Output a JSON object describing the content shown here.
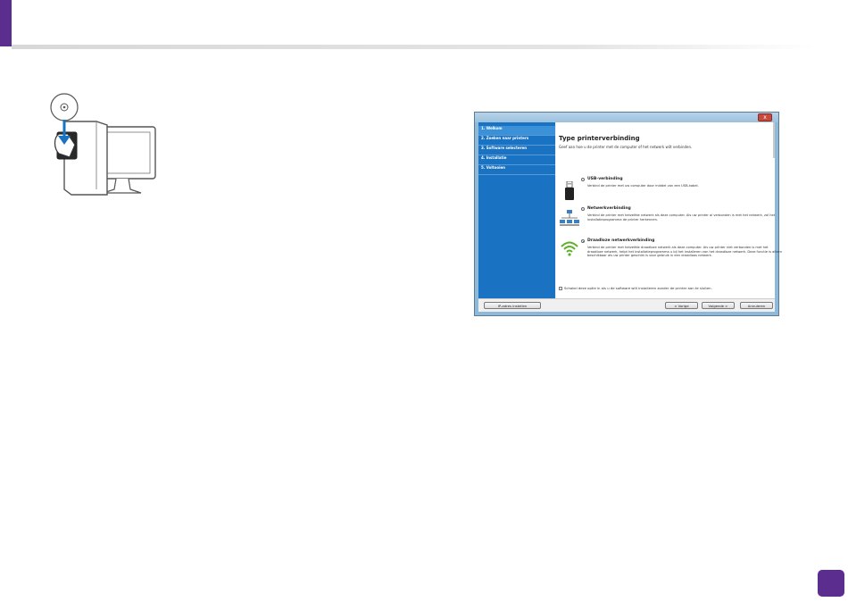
{
  "colors": {
    "accent": "#5b2d8e",
    "sidebar": "#1a73c2",
    "sidebar_active": "#3b91d8"
  },
  "installer": {
    "close_label": "x",
    "sidebar": [
      {
        "label": "1. Welkom"
      },
      {
        "label": "2. Zoeken naar printers"
      },
      {
        "label": "3. Software selecteren"
      },
      {
        "label": "4. Installatie"
      },
      {
        "label": "5. Voltooien"
      }
    ],
    "title": "Type printerverbinding",
    "subtitle": "Geef aan hoe u de printer met de computer of het netwerk wilt verbinden.",
    "options": [
      {
        "title": "USB-verbinding",
        "icon": "usb-cable-icon",
        "selected": false,
        "desc": "Verbind de printer met uw computer door middel van een USB-kabel."
      },
      {
        "title": "Netwerkverbinding",
        "icon": "network-icon",
        "selected": false,
        "desc": "Verbind de printer met hetzelfde netwerk als deze computer. Als uw printer al verbonden is met het netwerk, zal het installatieprogramma de printer herkennen."
      },
      {
        "title": "Draadloze netwerkverbinding",
        "icon": "wifi-icon",
        "selected": true,
        "desc": "Verbind de printer met hetzelfde draadloze netwerk als deze computer. Als uw printer niet verbonden is met het draadloze netwerk, helpt het installatieprogramma u bij het installeren van het draadloze netwerk. Deze functie is alleen beschikbaar als uw printer geschikt is voor gebruik in een draadloos netwerk."
      }
    ],
    "checkbox_label": "Schakel deze optie in als u de software wilt installeren zonder de printer aan te sluiten.",
    "buttons": {
      "ip": "IP-adres instellen",
      "back": "< Vorige",
      "next": "Volgende >",
      "cancel": "Annuleren"
    }
  }
}
